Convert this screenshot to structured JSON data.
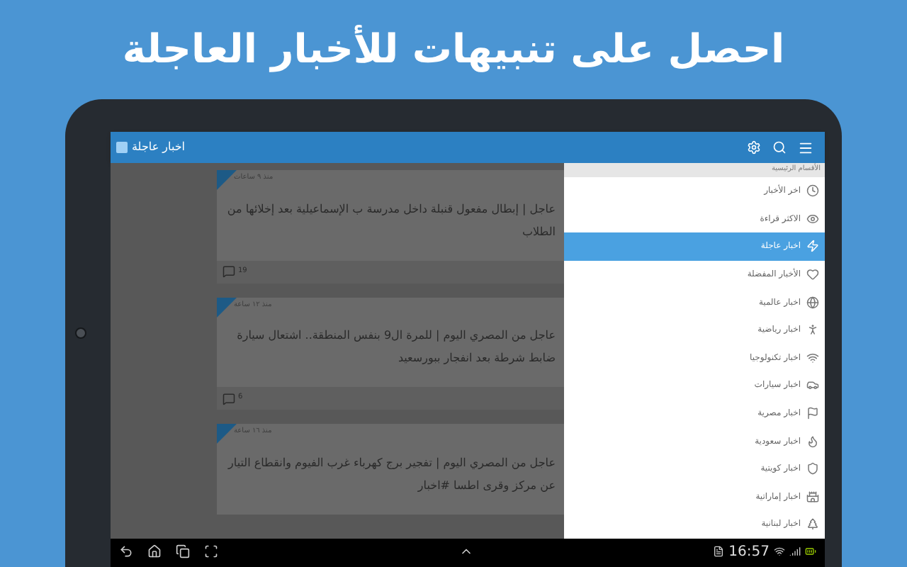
{
  "headline": "احصل على تنبيهات للأخبار العاجلة",
  "app_bar": {
    "title": "اخبار عاجلة"
  },
  "feed": [
    {
      "time": "منذ ٩ ساعات",
      "text": "عاجل | إبطال مفعول قنبلة داخل مدرسة ب الإسماعيلية بعد إخلائها من الطلاب",
      "comments": "19"
    },
    {
      "time": "منذ ١٢ ساعة",
      "text": "عاجل من المصري اليوم | للمرة ال9 بنفس المنطقة.. اشتعال سيارة ضابط شرطة بعد انفجار ببورسعيد",
      "comments": "6"
    },
    {
      "time": "منذ ١٦ ساعة",
      "text": "عاجل من المصري اليوم | تفجير برج كهرباء غرب الفيوم وانقطاع التيار عن مركز وقرى اطسا #اخبار"
    }
  ],
  "drawer": {
    "section": "الأقسام الرئيسية",
    "items": [
      {
        "label": "اخر الأخبار",
        "selected": false
      },
      {
        "label": "الاكثر قراءة",
        "selected": false
      },
      {
        "label": "اخبار عاجلة",
        "selected": true
      },
      {
        "label": "الأخبار المفضلة",
        "selected": false
      },
      {
        "label": "اخبار عالمية",
        "selected": false
      },
      {
        "label": "اخبار رياضية",
        "selected": false
      },
      {
        "label": "اخبار تكنولوجيا",
        "selected": false
      },
      {
        "label": "اخبار سيارات",
        "selected": false
      },
      {
        "label": "اخبار مصرية",
        "selected": false
      },
      {
        "label": "اخبار سعودية",
        "selected": false
      },
      {
        "label": "اخبار كويتية",
        "selected": false
      },
      {
        "label": "اخبار إماراتية",
        "selected": false
      },
      {
        "label": "اخبار لبنانية",
        "selected": false
      }
    ]
  },
  "status_bar": {
    "time": "16:57"
  }
}
